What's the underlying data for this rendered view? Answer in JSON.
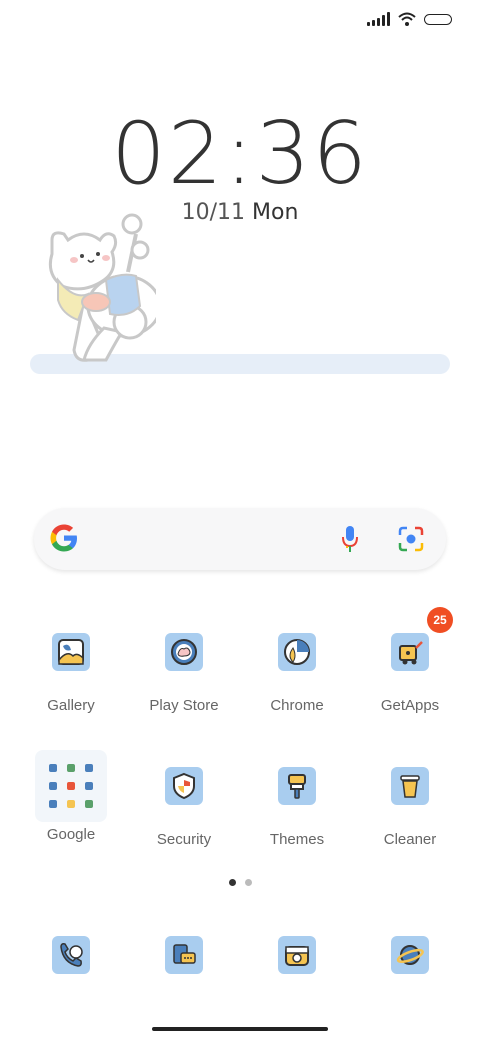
{
  "status_bar": {
    "signal_icon": "signal-icon",
    "wifi_icon": "wifi-icon",
    "battery_icon": "battery-icon"
  },
  "clock": {
    "time": "02:36",
    "date": "10/11",
    "day": "Mon"
  },
  "search": {
    "logo": "google-g-icon",
    "mic": "mic-icon",
    "lens": "camera-lens-icon"
  },
  "apps": [
    {
      "label": "Gallery"
    },
    {
      "label": "Play Store"
    },
    {
      "label": "Chrome"
    },
    {
      "label": "GetApps",
      "badge": "25"
    },
    {
      "label": "Google"
    },
    {
      "label": "Security"
    },
    {
      "label": "Themes"
    },
    {
      "label": "Cleaner"
    }
  ],
  "page_indicator": {
    "pages": 2,
    "current": 1
  },
  "colors": {
    "icon_bg": "#a9cdef",
    "badge": "#f04e23",
    "widget_bar": "#e6eef8"
  }
}
